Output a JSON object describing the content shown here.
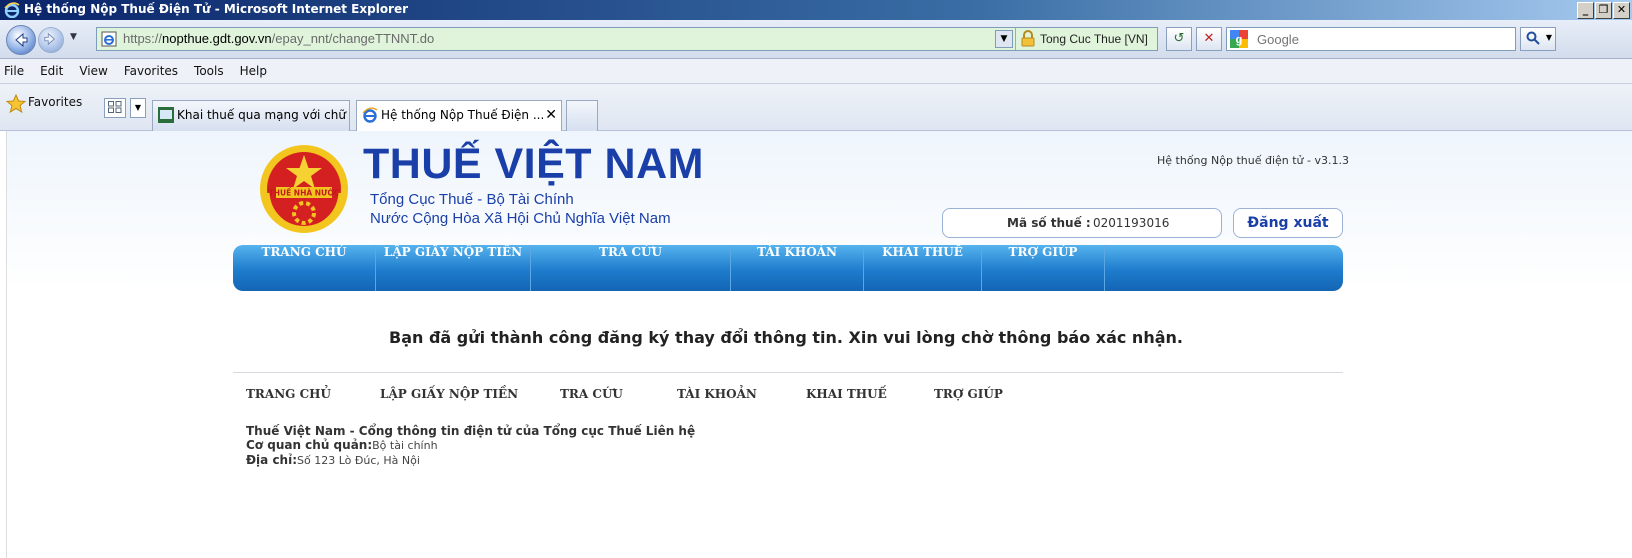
{
  "window": {
    "title": "Hệ thống Nộp Thuế Điện Tử - Microsoft Internet Explorer",
    "min_label": "_",
    "max_label": "❐",
    "close_label": "✕"
  },
  "addressbar": {
    "url_scheme": "https://",
    "url_host": "nopthue.gdt.gov.vn",
    "url_path": "/epay_nnt/changeTTNNT.do",
    "cert_text": "Tong Cuc Thue [VN]",
    "refresh_icon": "↺",
    "stop_icon": "✕",
    "search_placeholder": "Google"
  },
  "menu": {
    "items": [
      "File",
      "Edit",
      "View",
      "Favorites",
      "Tools",
      "Help"
    ]
  },
  "favbar": {
    "favorites_label": "Favorites",
    "tabs": [
      {
        "label": "Khai thuế qua mạng với chữ ..."
      },
      {
        "label": "Hệ thống Nộp Thuế Điện ...",
        "close": "✕"
      }
    ]
  },
  "page": {
    "brand_title": "THUẾ VIỆT NAM",
    "brand_sub1": "Tổng Cục Thuế - Bộ Tài Chính",
    "brand_sub2": "Nước Cộng Hòa Xã Hội Chủ Nghĩa Việt Nam",
    "emblem_text": "THUẾ NHÀ NƯỚC",
    "version": "Hệ thống Nộp thuế điện tử - v3.1.3",
    "mst_label": "Mã số thuế :",
    "mst_value": "0201193016",
    "logout_label": "Đăng xuất",
    "nav": [
      "TRANG CHỦ",
      "LẬP GIẤY NỘP TIỀN",
      "TRA CỨU",
      "TÀI KHOẢN",
      "KHAI THUẾ",
      "TRỢ GIÚP"
    ],
    "success_message": "Bạn đã gửi thành công đăng ký thay đổi thông tin. Xin vui lòng chờ thông báo xác nhận.",
    "footer_nav": [
      "TRANG CHỦ",
      "LẬP GIẤY NỘP TIỀN",
      "TRA CỨU",
      "TÀI KHOẢN",
      "KHAI THUẾ",
      "TRỢ GIÚP"
    ],
    "footer_line1": "Thuế Việt Nam - Cổng thông tin điện tử của Tổng cục Thuế Liên hệ",
    "footer_agency_label": "Cơ quan chủ quản:",
    "footer_agency_value": "Bộ tài chính",
    "footer_address_label": "Địa chỉ:",
    "footer_address_value": "Số 123 Lò Đúc, Hà Nội"
  },
  "colors": {
    "brand_blue": "#1a3fa8",
    "nav_blue": "#1e7ccd",
    "url_bg_secure": "#e0f4dc"
  }
}
